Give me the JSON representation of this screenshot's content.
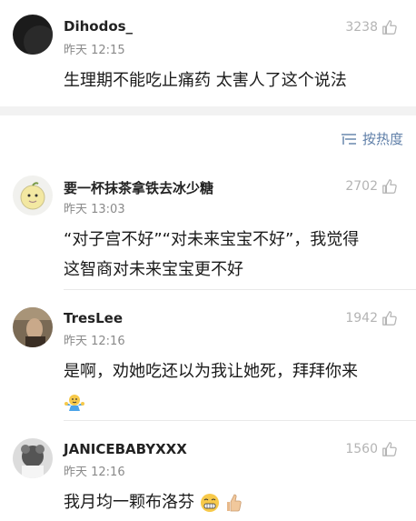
{
  "sort": {
    "label": "按热度"
  },
  "comments": [
    {
      "author": "Dihodos_",
      "time": "昨天 12:15",
      "likes": "3238",
      "lines": [
        "生理期不能吃止痛药 太害人了这个说法"
      ]
    },
    {
      "author": "要一杯抹茶拿铁去冰少糖",
      "time": "昨天 13:03",
      "likes": "2702",
      "lines": [
        "“对子宫不好”“对未来宝宝不好”，我觉得",
        "这智商对未来宝宝更不好"
      ]
    },
    {
      "author": "TresLee",
      "time": "昨天 12:16",
      "likes": "1942",
      "lines": [
        "是啊，劝她吃还以为我让她死，拜拜你来"
      ]
    },
    {
      "author": "JANICEBABYXXX",
      "time": "昨天 12:16",
      "likes": "1560",
      "lines": [
        "我月均一颗布洛芬"
      ]
    }
  ],
  "icons": {
    "like": "thumbs-up-icon",
    "sort": "sort-icon"
  },
  "colors": {
    "link": "#5f7fa8",
    "muted": "#8a8a8a",
    "likes": "#b4b4b4",
    "band": "#f2f2f2"
  }
}
